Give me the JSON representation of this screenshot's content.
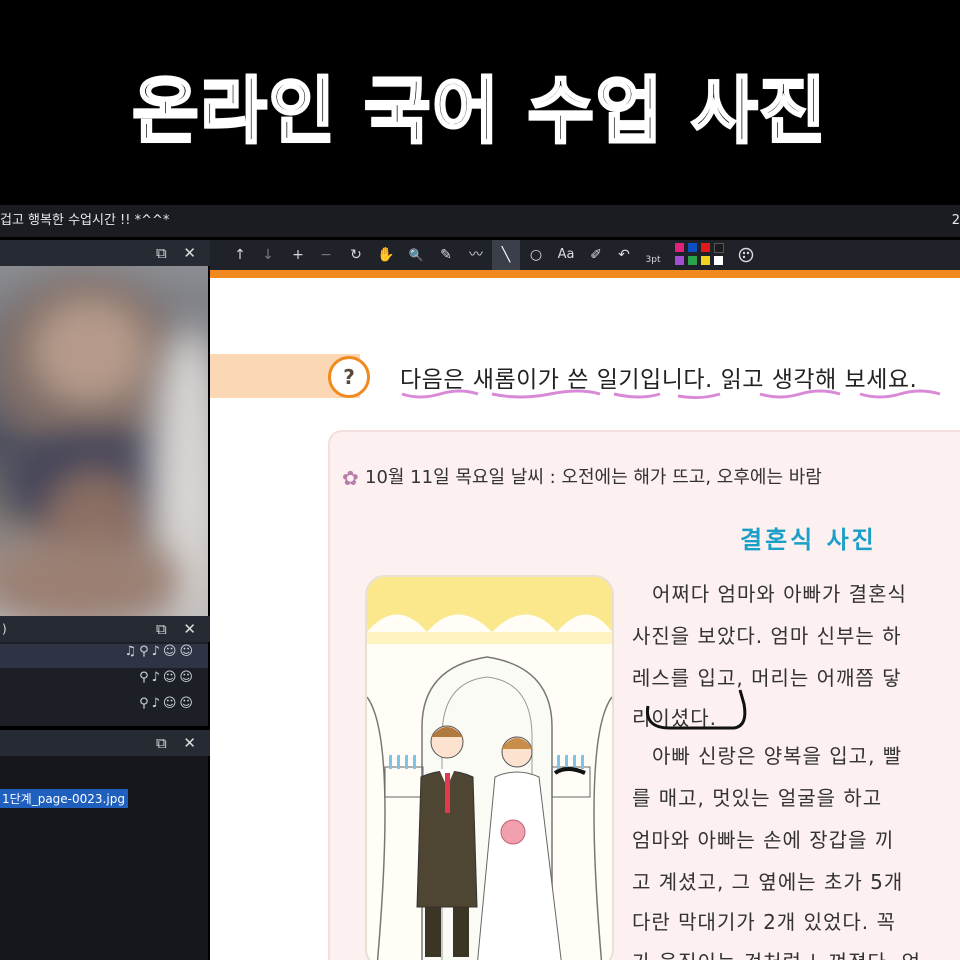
{
  "banner": {
    "title": "온라인 국어 수업 사진"
  },
  "window": {
    "title": "겁고 행복한 수업시간 !! *^^*",
    "right_indicator": "2"
  },
  "panes": {
    "video": {
      "controls": "⧉ ✕"
    },
    "participants": {
      "label": ")",
      "controls": "⧉ ✕",
      "rows": [
        {
          "icons": "♫⚲♪☺☺"
        },
        {
          "icons": "⚲♪☺☺"
        },
        {
          "icons": "⚲♪☺☺"
        }
      ]
    },
    "files": {
      "controls": "⧉ ✕",
      "item": "1단계_page-0023.jpg"
    }
  },
  "toolbar": {
    "tools": [
      "↑",
      "↓",
      "+",
      "−",
      "↻",
      "✋",
      "🔍",
      "✎",
      "〰",
      "╲",
      "○",
      "Aa",
      "✐",
      "↶",
      "⇒"
    ],
    "line_width": "3pt",
    "colors": [
      "#e3217c",
      "#0b4fc2",
      "#e11a1a",
      "#1b1b1b",
      "#a14fd0",
      "#2aa34a",
      "#f2d320",
      "#ffffff"
    ]
  },
  "doc": {
    "instruction": "다음은 새롬이가 쓴 일기입니다. 읽고 생각해 보세요.",
    "date_line": "10월 11일 목요일 날씨 : 오전에는 해가 뜨고, 오후에는 바람",
    "story_title": "결혼식 사진",
    "lines": [
      "어쩌다 엄마와 아빠가 결혼식",
      "사진을 보았다. 엄마 신부는 하",
      "레스를 입고, 머리는 어깨쯤 닿",
      "리이셨다.",
      "아빠 신랑은 양복을 입고, 빨",
      "를 매고, 멋있는 얼굴을 하고",
      "엄마와 아빠는 손에 장갑을 끼",
      "고 계셨고, 그 옆에는 초가 5개",
      "다란 막대기가 2개 있었다. 꼭",
      "가 움직이는 것처럼 느껴졌다. 엄"
    ]
  }
}
